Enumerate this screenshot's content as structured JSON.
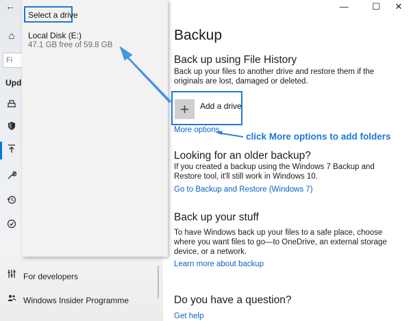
{
  "window": {
    "back_icon": "arrow-left-icon",
    "minimize": "—",
    "maximize": "☐",
    "close": "✕"
  },
  "nav": {
    "find_placeholder": "Fi",
    "section_heading": "Upd",
    "icons": [
      "home-icon",
      "delivery-icon",
      "shield-icon",
      "backup-icon",
      "wrench-icon",
      "history-icon",
      "check-circle-icon",
      "developer-icon",
      "insider-icon"
    ],
    "items": [
      {
        "label": "For developers",
        "icon": "developer-icon"
      },
      {
        "label": "Windows Insider Programme",
        "icon": "insider-icon"
      }
    ]
  },
  "flyout": {
    "title": "Select a drive",
    "drive_name": "Local Disk (E:)",
    "drive_free": "47.1 GB free of 59.8 GB"
  },
  "content": {
    "title": "Backup",
    "file_history": {
      "heading": "Back up using File History",
      "description": "Back up your files to another drive and restore them if the originals are lost, damaged or deleted.",
      "add_drive_label": "Add a drive",
      "more_options": "More options"
    },
    "older": {
      "heading": "Looking for an older backup?",
      "description": "If you created a backup using the Windows 7 Backup and Restore tool, it'll still work in Windows 10.",
      "link": "Go to Backup and Restore (Windows 7)"
    },
    "stuff": {
      "heading": "Back up your stuff",
      "description": "To have Windows back up your files to a safe place, choose where you want files to go—to OneDrive, an external storage device, or a network.",
      "link": "Learn more about backup"
    },
    "question": {
      "heading": "Do you have a question?",
      "link": "Get help"
    }
  },
  "annotation": {
    "text": "click More options to add folders",
    "color": "#1c78d4"
  },
  "colors": {
    "accent": "#0078d7",
    "link": "#0a62c7",
    "highlight_box": "#1e78d8"
  }
}
